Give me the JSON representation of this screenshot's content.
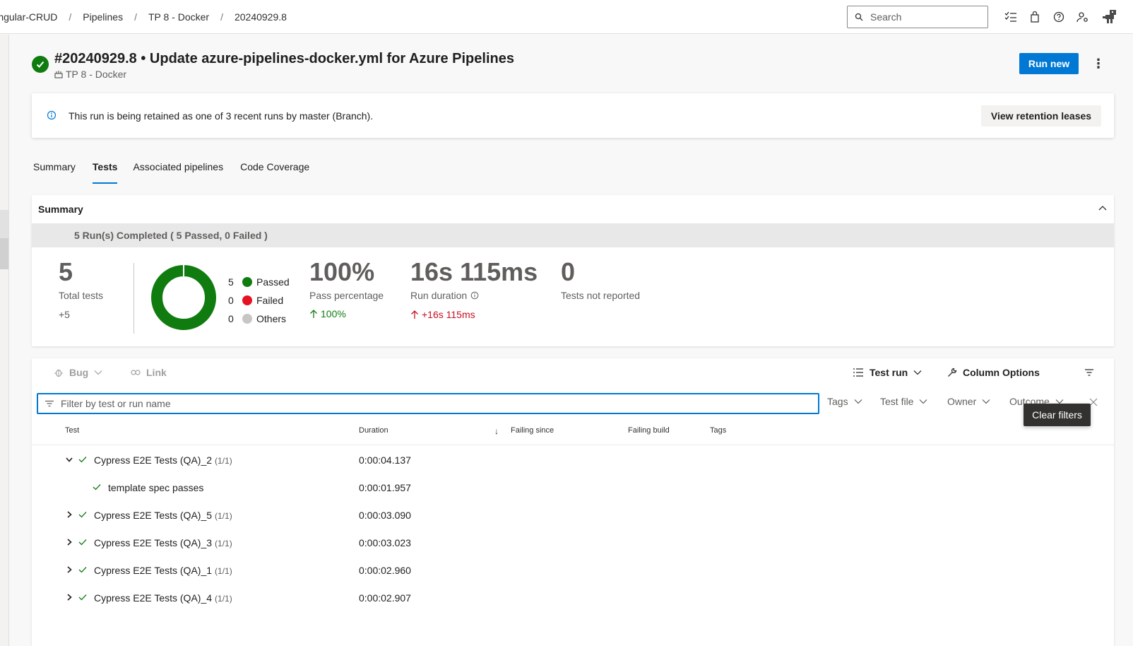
{
  "breadcrumb": [
    "Angular-CRUD",
    "Pipelines",
    "TP 8 - Docker",
    "20240929.8"
  ],
  "search": {
    "placeholder": "Search"
  },
  "run": {
    "title": "#20240929.8 • Update azure-pipelines-docker.yml for Azure Pipelines",
    "pipeline": "TP 8 - Docker",
    "run_new_label": "Run new"
  },
  "banner": {
    "message": "This run is being retained as one of 3 recent runs by master (Branch).",
    "button_label": "View retention leases"
  },
  "tabs": [
    {
      "label": "Summary",
      "active": false
    },
    {
      "label": "Tests",
      "active": true
    },
    {
      "label": "Associated pipelines",
      "active": false
    },
    {
      "label": "Code Coverage",
      "active": false
    }
  ],
  "summary": {
    "heading": "Summary",
    "runs_completed": "5 Run(s) Completed ( 5 Passed, 0 Failed )",
    "total_tests": {
      "value": "5",
      "label": "Total tests",
      "delta": "+5"
    },
    "legend": [
      {
        "count": "5",
        "label": "Passed",
        "color": "#107c10"
      },
      {
        "count": "0",
        "label": "Failed",
        "color": "#e81123"
      },
      {
        "count": "0",
        "label": "Others",
        "color": "#c8c6c4"
      }
    ],
    "pass_percentage": {
      "value": "100%",
      "label": "Pass percentage",
      "delta": "100%"
    },
    "run_duration": {
      "value": "16s 115ms",
      "label": "Run duration",
      "delta": "+16s 115ms"
    },
    "not_reported": {
      "value": "0",
      "label": "Tests not reported"
    }
  },
  "toolbar": {
    "bug": "Bug",
    "link": "Link",
    "test_run": "Test run",
    "column_options": "Column Options"
  },
  "filter": {
    "placeholder": "Filter by test or run name",
    "dropdowns": [
      "Tags",
      "Test file",
      "Owner",
      "Outcome"
    ],
    "tooltip": "Clear filters"
  },
  "columns": {
    "test": "Test",
    "duration": "Duration",
    "failing_since": "Failing since",
    "failing_build": "Failing build",
    "tags": "Tags"
  },
  "rows": [
    {
      "name": "Cypress E2E Tests (QA)_2",
      "count": "(1/1)",
      "duration": "0:00:04.137",
      "expanded": true,
      "child": false
    },
    {
      "name": "template spec passes",
      "count": "",
      "duration": "0:00:01.957",
      "expanded": false,
      "child": true
    },
    {
      "name": "Cypress E2E Tests (QA)_5",
      "count": "(1/1)",
      "duration": "0:00:03.090",
      "expanded": false,
      "child": false
    },
    {
      "name": "Cypress E2E Tests (QA)_3",
      "count": "(1/1)",
      "duration": "0:00:03.023",
      "expanded": false,
      "child": false
    },
    {
      "name": "Cypress E2E Tests (QA)_1",
      "count": "(1/1)",
      "duration": "0:00:02.960",
      "expanded": false,
      "child": false
    },
    {
      "name": "Cypress E2E Tests (QA)_4",
      "count": "(1/1)",
      "duration": "0:00:02.907",
      "expanded": false,
      "child": false
    }
  ],
  "colors": {
    "accent": "#0078d4",
    "success": "#107c10",
    "danger": "#c50f1f"
  }
}
